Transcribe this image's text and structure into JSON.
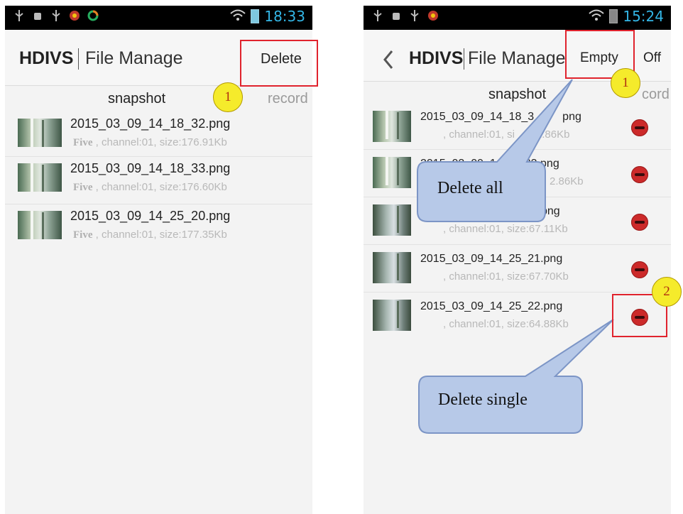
{
  "left": {
    "status": {
      "time": "18:33"
    },
    "actionbar": {
      "app_name": "HDIVS",
      "title": "File Manage",
      "delete_label": "Delete"
    },
    "tabs": {
      "snapshot": "snapshot",
      "record": "record"
    },
    "files": [
      {
        "name": "2015_03_09_14_18_32.png",
        "device": "Five",
        "info": ", channel:01, size:176.91Kb"
      },
      {
        "name": "2015_03_09_14_18_33.png",
        "device": "Five",
        "info": ", channel:01, size:176.60Kb"
      },
      {
        "name": "2015_03_09_14_25_20.png",
        "device": "Five",
        "info": ", channel:01, size:177.35Kb"
      }
    ],
    "badge": "1"
  },
  "right": {
    "status": {
      "time": "15:24"
    },
    "actionbar": {
      "app_name": "HDIVS",
      "title": "File Manage",
      "empty_label": "Empty",
      "off_label": "Off"
    },
    "tabs": {
      "snapshot": "snapshot",
      "record": "cord"
    },
    "files": [
      {
        "name": "2015_03_09_14_18_3",
        "name_tail": "png",
        "info": ", channel:01, si",
        "info_tail": "2.86Kb"
      },
      {
        "name": "2015_03_09_1",
        "name_tail": "33.png",
        "info": "",
        "info_tail": "2.86Kb"
      },
      {
        "name": "",
        "name_tail": "png",
        "info": ", channel:01, size:67.11Kb",
        "info_tail": ""
      },
      {
        "name": "2015_03_09_14_25_21.png",
        "name_tail": "",
        "info": ", channel:01, size:67.70Kb",
        "info_tail": ""
      },
      {
        "name": "2015_03_09_14_25_22.png",
        "name_tail": "",
        "info": ", channel:01, size:64.88Kb",
        "info_tail": ""
      }
    ],
    "badges": [
      "1",
      "2"
    ],
    "callouts": {
      "delete_all": "Delete all",
      "delete_single": "Delete single"
    }
  },
  "colors": {
    "highlight": "#e0232d",
    "badge": "#f5eb2b",
    "callout": "#b7c9e8",
    "delete_icon": "#cc2a2a",
    "clock": "#33b5e5"
  }
}
